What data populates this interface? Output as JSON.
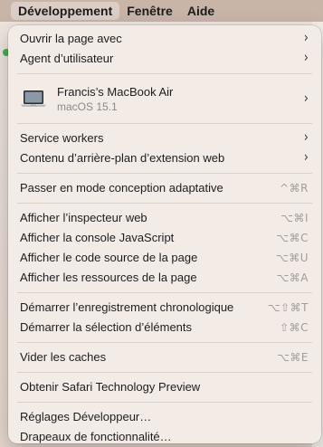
{
  "menubar": {
    "items": [
      "Développement",
      "Fenêtre",
      "Aide"
    ]
  },
  "menu": {
    "ouvrir_page": "Ouvrir la page avec",
    "agent": "Agent d’utilisateur",
    "device_name": "Francis’s MacBook Air",
    "device_os": "macOS 15.1",
    "service_workers": "Service workers",
    "contenu_extension": "Contenu d’arrière-plan d’extension web",
    "passer_adaptative": "Passer en mode conception adaptative",
    "passer_adaptative_short": "^⌘R",
    "inspecteur": "Afficher l’inspecteur web",
    "inspecteur_short": "⌥⌘I",
    "console": "Afficher la console JavaScript",
    "console_short": "⌥⌘C",
    "source": "Afficher le code source de la page",
    "source_short": "⌥⌘U",
    "ressources": "Afficher les ressources de la page",
    "ressources_short": "⌥⌘A",
    "enregistrement": "Démarrer l’enregistrement chronologique",
    "enregistrement_short": "⌥⇧⌘T",
    "selection": "Démarrer la sélection d’éléments",
    "selection_short": "⇧⌘C",
    "vider_caches": "Vider les caches",
    "vider_caches_short": "⌥⌘E",
    "obtenir_stp": "Obtenir Safari Technology Preview",
    "reglages": "Réglages Développeur…",
    "drapeaux": "Drapeaux de fonctionnalité…"
  },
  "icons": {
    "submenu": "chevron-right-icon",
    "device": "laptop-icon"
  }
}
